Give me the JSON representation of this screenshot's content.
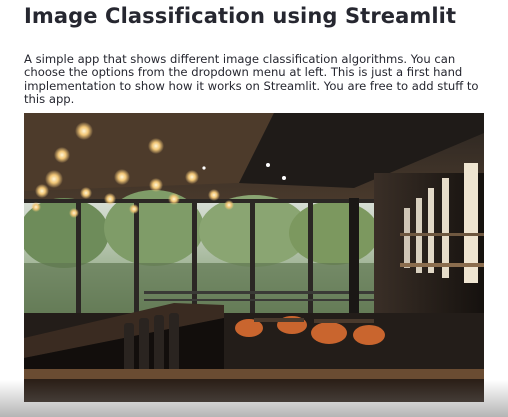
{
  "page": {
    "title": "Image Classification using Streamlit",
    "description": "A simple app that shows different image classification algorithms. You can choose the options from the dropdown menu at left. This is just a first hand implementation to show how it works on Streamlit. You are free to add stuff to this app."
  },
  "colors": {
    "text": "#262730",
    "background": "#ffffff"
  },
  "image": {
    "subject": "restaurant-interior-photo"
  }
}
